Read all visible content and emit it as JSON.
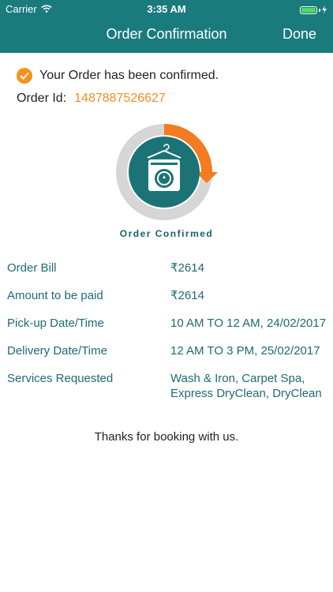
{
  "status_bar": {
    "carrier": "Carrier",
    "time": "3:35 AM"
  },
  "nav": {
    "title": "Order Confirmation",
    "done_label": "Done"
  },
  "confirmation": {
    "message": "Your Order has been confirmed.",
    "order_id_label": "Order Id:",
    "order_id_value": "1487887526627"
  },
  "progress": {
    "label": "Order Confirmed",
    "fraction": 0.25
  },
  "details": [
    {
      "label": "Order Bill",
      "value": "₹2614"
    },
    {
      "label": "Amount to be paid",
      "value": "₹2614"
    },
    {
      "label": "Pick-up Date/Time",
      "value": "10 AM TO 12 AM, 24/02/2017"
    },
    {
      "label": "Delivery Date/Time",
      "value": "12 AM TO 3 PM, 25/02/2017"
    },
    {
      "label": "Services Requested",
      "value": "Wash & Iron, Carpet Spa, Express DryClean, DryClean"
    }
  ],
  "footer": {
    "thanks": "Thanks for booking with us."
  },
  "colors": {
    "header": "#1a7b7c",
    "accent": "#f5921e",
    "text_teal": "#1d6a75"
  },
  "icons": [
    "wifi-icon",
    "battery-icon",
    "charging-icon",
    "check-icon",
    "washing-machine-icon"
  ]
}
